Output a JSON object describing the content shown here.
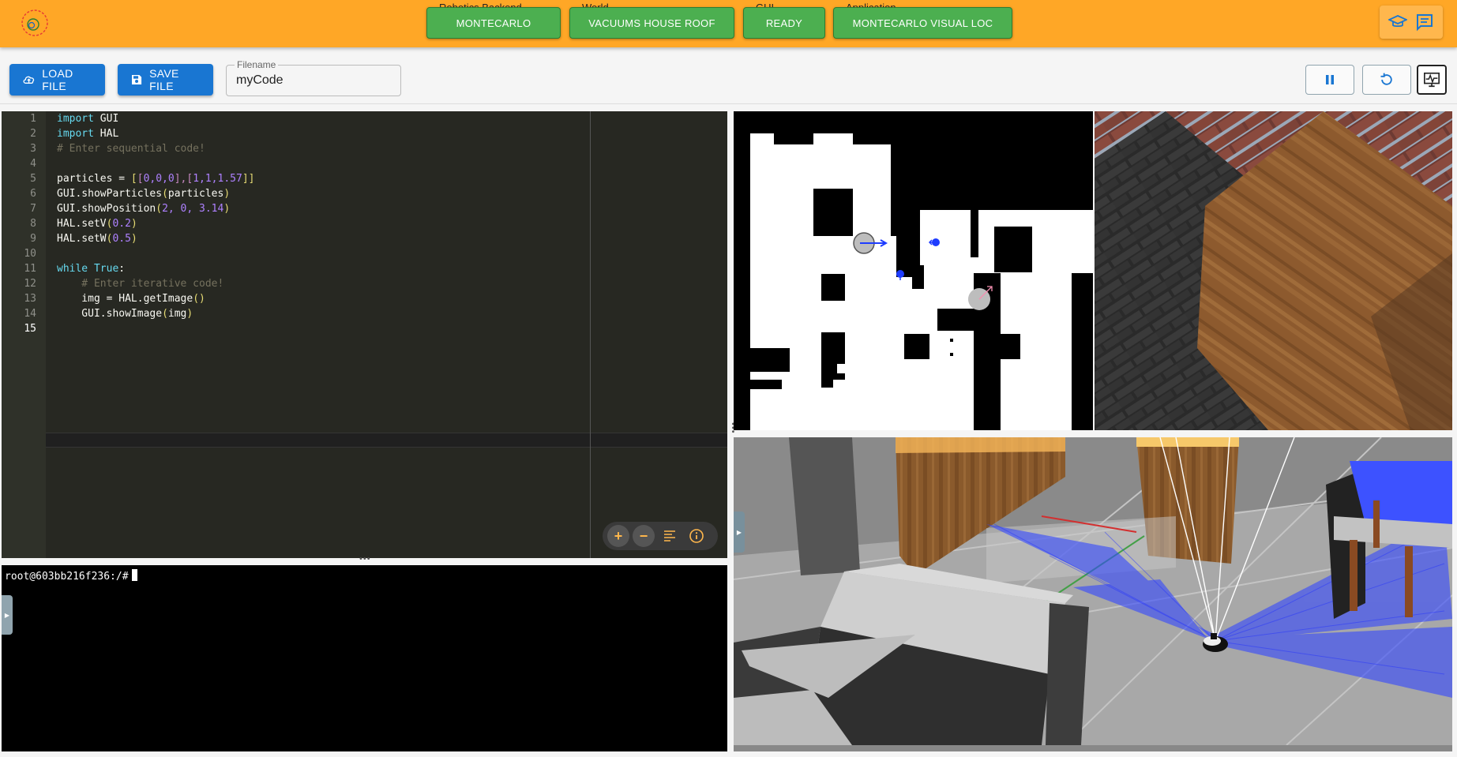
{
  "header": {
    "statuses": [
      {
        "caption": "Robotics Backend",
        "value": "MONTECARLO"
      },
      {
        "caption": "World",
        "value": "VACUUMS HOUSE ROOF"
      },
      {
        "caption": "GUI",
        "value": "READY"
      },
      {
        "caption": "Application",
        "value": "MONTECARLO VISUAL LOC"
      }
    ],
    "icons": [
      "graduation-cap-icon",
      "chat-icon"
    ],
    "colors": {
      "bar": "#ffa726",
      "status": "#4caf50"
    }
  },
  "toolbar": {
    "load_label": "LOAD FILE",
    "save_label": "SAVE FILE",
    "filename_label": "Filename",
    "filename_value": "myCode"
  },
  "editor": {
    "lines": [
      {
        "n": "1"
      },
      {
        "n": "2"
      },
      {
        "n": "3"
      },
      {
        "n": "4"
      },
      {
        "n": "5"
      },
      {
        "n": "6"
      },
      {
        "n": "7"
      },
      {
        "n": "8"
      },
      {
        "n": "9"
      },
      {
        "n": "10"
      },
      {
        "n": "11"
      },
      {
        "n": "12"
      },
      {
        "n": "13"
      },
      {
        "n": "14"
      },
      {
        "n": "15"
      }
    ],
    "code": {
      "l1_kw": "import",
      "l1_rest": " GUI",
      "l2_kw": "import",
      "l2_rest": " HAL",
      "l3": "# Enter sequential code!",
      "l5_a": "particles = ",
      "l5_b": "[",
      "l5_c": "[",
      "l5_d": "0,0,0",
      "l5_e": "],[",
      "l5_f": "1,1,1.57",
      "l5_g": "]]",
      "l6_a": "GUI.showParticles",
      "l6_b": "(",
      "l6_c": "particles",
      "l6_d": ")",
      "l7_a": "GUI.showPosition",
      "l7_b": "(",
      "l7_c": "2, 0, 3.14",
      "l7_d": ")",
      "l8_a": "HAL.setV",
      "l8_b": "(",
      "l8_c": "0.2",
      "l8_d": ")",
      "l9_a": "HAL.setW",
      "l9_b": "(",
      "l9_c": "0.5",
      "l9_d": ")",
      "l11_kw": "while",
      "l11_b": " ",
      "l11_c": "True",
      "l11_d": ":",
      "l12": "    # Enter iterative code!",
      "l13_a": "    img = HAL.getImage",
      "l13_b": "()",
      "l14_a": "    GUI.showImage",
      "l14_b": "(",
      "l14_c": "img",
      "l14_d": ")"
    },
    "tools": [
      "zoom-in-icon",
      "zoom-out-icon",
      "format-icon",
      "info-icon"
    ]
  },
  "terminal": {
    "prompt": "root@603bb216f236:/#"
  }
}
